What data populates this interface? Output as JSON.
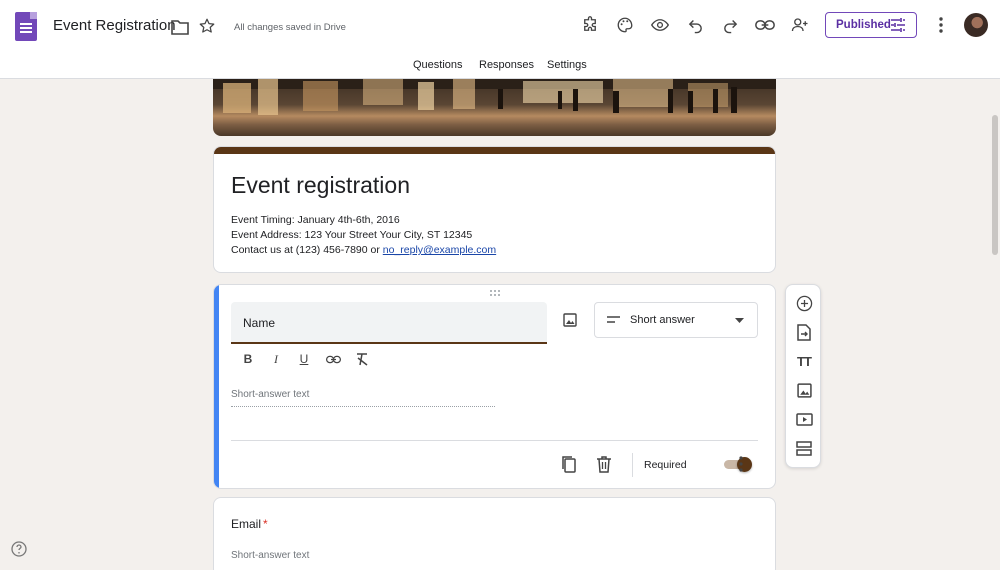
{
  "header": {
    "doc_title": "Event Registration",
    "save_status": "All changes saved in Drive",
    "publish_label": "Published",
    "icons": [
      "forms-logo-icon",
      "folder-icon",
      "star-icon",
      "addon-puzzle-icon",
      "palette-icon",
      "preview-eye-icon",
      "undo-icon",
      "redo-icon",
      "link-icon",
      "add-collaborator-icon",
      "more-vert-icon",
      "avatar"
    ]
  },
  "tabs": [
    {
      "label": "Questions",
      "active": true
    },
    {
      "label": "Responses",
      "active": false
    },
    {
      "label": "Settings",
      "active": false
    }
  ],
  "form": {
    "title": "Event registration",
    "description": {
      "line1": "Event Timing: January 4th-6th, 2016",
      "line2": "Event Address: 123 Your Street Your City, ST 12345",
      "line3_prefix": "Contact us at (123) 456-7890 or ",
      "line3_link": "no_reply@example.com"
    },
    "accent_color": "#5a3616"
  },
  "question_active": {
    "title": "Name",
    "type": "Short answer",
    "answer_placeholder": "Short-answer text",
    "required_label": "Required",
    "required": true,
    "format_buttons": [
      "bold-icon",
      "italic-icon",
      "underline-icon",
      "link-icon",
      "clear-format-icon"
    ],
    "format_labels": {
      "bold": "B",
      "italic": "I",
      "underline": "U"
    }
  },
  "question_email": {
    "title": "Email",
    "required_mark": "*",
    "answer_placeholder": "Short-answer text"
  },
  "side_toolbar": [
    "add-question-icon",
    "import-questions-icon",
    "add-title-icon",
    "add-image-icon",
    "add-video-icon",
    "add-section-icon"
  ],
  "side_toolbar_text": {
    "title_glyph": "TT"
  }
}
